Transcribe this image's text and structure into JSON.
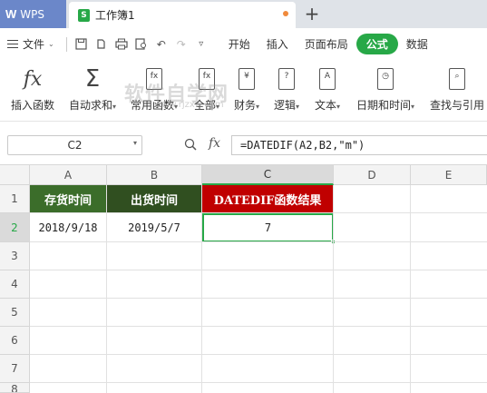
{
  "tabs": {
    "app_name": "WPS",
    "doc_name": "工作簿1",
    "doc_icon": "S",
    "new_tab_symbol": "+"
  },
  "menu": {
    "file_label": "文件",
    "items": [
      "开始",
      "插入",
      "页面布局",
      "公式",
      "数据"
    ],
    "active": "公式"
  },
  "ribbon": {
    "buttons": [
      {
        "icon": "fx-icon",
        "label": "插入函数"
      },
      {
        "icon": "sigma-icon",
        "label": "自动求和"
      },
      {
        "icon": "recent-function-icon",
        "label": "常用函数"
      },
      {
        "icon": "all-function-icon",
        "label": "全部"
      },
      {
        "icon": "finance-icon",
        "label": "财务"
      },
      {
        "icon": "logic-icon",
        "label": "逻辑"
      },
      {
        "icon": "text-icon",
        "label": "文本"
      },
      {
        "icon": "datetime-icon",
        "label": "日期和时间"
      },
      {
        "icon": "lookup-icon",
        "label": "查找与引用"
      }
    ],
    "watermark": "软件自学网",
    "watermark_sub": "www.rjzxw.com"
  },
  "formula_bar": {
    "cell_ref": "C2",
    "fx_label": "fx",
    "formula": "=DATEDIF(A2,B2,\"m\")"
  },
  "sheet": {
    "columns": [
      "A",
      "B",
      "C",
      "D",
      "E"
    ],
    "active_column": "C",
    "rows": [
      "1",
      "2",
      "3",
      "4",
      "5",
      "6",
      "7",
      "8"
    ],
    "active_row": "2",
    "headers": [
      "存货时间",
      "出货时间",
      "DATEDIF函数结果"
    ],
    "header_colors": [
      "#3b6d2a",
      "#304f20",
      "#c00000"
    ],
    "data_row": [
      "2018/9/18",
      "2019/5/7",
      "7"
    ],
    "accent": "#27a847"
  }
}
